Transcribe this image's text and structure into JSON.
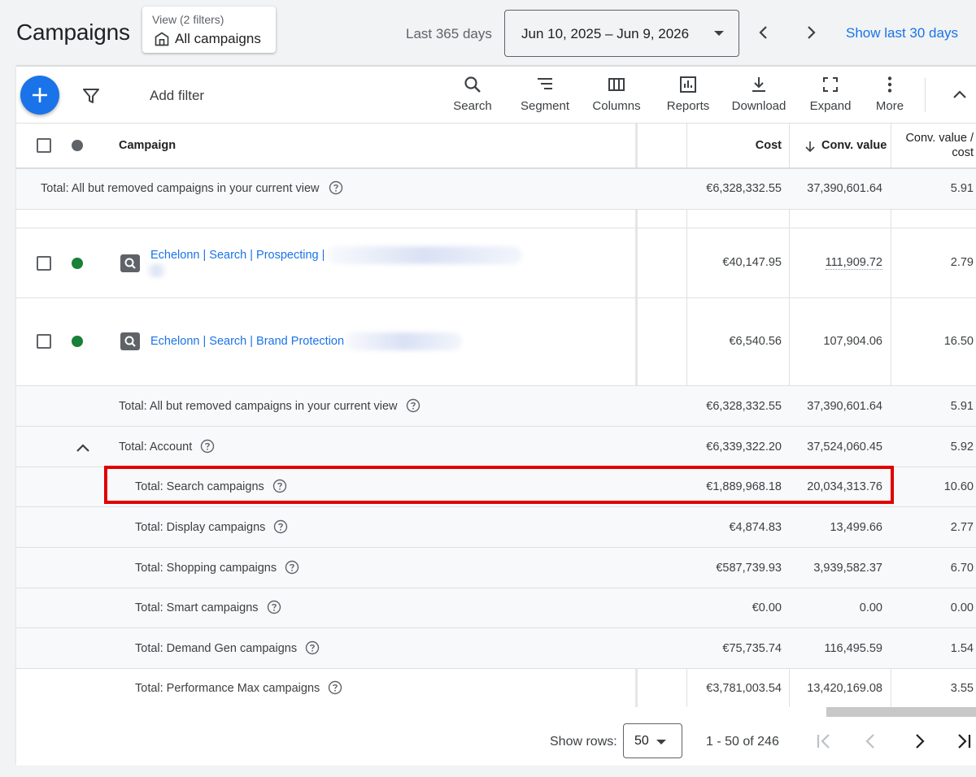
{
  "header": {
    "title": "Campaigns",
    "view_label": "View (2 filters)",
    "view_value": "All campaigns",
    "range_label": "Last 365 days",
    "date_range": "Jun 10, 2025 – Jun 9, 2026",
    "show_last": "Show last 30 days"
  },
  "toolbar": {
    "add_filter": "Add filter",
    "tools": [
      {
        "label": "Search",
        "icon": "search-icon"
      },
      {
        "label": "Segment",
        "icon": "segment-icon"
      },
      {
        "label": "Columns",
        "icon": "columns-icon"
      },
      {
        "label": "Reports",
        "icon": "reports-icon"
      },
      {
        "label": "Download",
        "icon": "download-icon"
      },
      {
        "label": "Expand",
        "icon": "expand-icon"
      },
      {
        "label": "More",
        "icon": "more-vert-icon"
      }
    ]
  },
  "table": {
    "columns": {
      "campaign": "Campaign",
      "cost": "Cost",
      "conv_value": "Conv. value",
      "conv_value_cost_line1": "Conv. value /",
      "conv_value_cost_line2": "cost"
    },
    "total_top": {
      "label": "Total: All but removed campaigns in your current view",
      "cost": "€6,328,332.55",
      "conv_value": "37,390,601.64",
      "ratio": "5.91"
    },
    "campaigns": [
      {
        "name": "Echelonn | Search | Prospecting |",
        "status_color": "#188038",
        "cost": "€40,147.95",
        "conv_value": "111,909.72",
        "ratio": "2.79"
      },
      {
        "name": "Echelonn | Search | Brand Protection",
        "status_color": "#188038",
        "cost": "€6,540.56",
        "conv_value": "107,904.06",
        "ratio": "16.50"
      }
    ],
    "totals": [
      {
        "label": "Total: All but removed campaigns in your current view",
        "cost": "€6,328,332.55",
        "conv_value": "37,390,601.64",
        "ratio": "5.91"
      },
      {
        "label": "Total: Account",
        "cost": "€6,339,322.20",
        "conv_value": "37,524,060.45",
        "ratio": "5.92"
      },
      {
        "label": "Total: Search campaigns",
        "cost": "€1,889,968.18",
        "conv_value": "20,034,313.76",
        "ratio": "10.60"
      },
      {
        "label": "Total: Display campaigns",
        "cost": "€4,874.83",
        "conv_value": "13,499.66",
        "ratio": "2.77"
      },
      {
        "label": "Total: Shopping campaigns",
        "cost": "€587,739.93",
        "conv_value": "3,939,582.37",
        "ratio": "6.70"
      },
      {
        "label": "Total: Smart campaigns",
        "cost": "€0.00",
        "conv_value": "0.00",
        "ratio": "0.00"
      },
      {
        "label": "Total: Demand Gen campaigns",
        "cost": "€75,735.74",
        "conv_value": "116,495.59",
        "ratio": "1.54"
      },
      {
        "label": "Total: Performance Max campaigns",
        "cost": "€3,781,003.54",
        "conv_value": "13,420,169.08",
        "ratio": "3.55"
      }
    ]
  },
  "footer": {
    "show_rows_label": "Show rows:",
    "rows_value": "50",
    "range_text": "1 - 50 of 246"
  },
  "colors": {
    "accent": "#1a73e8",
    "highlight": "#e00000",
    "enabled": "#188038"
  }
}
